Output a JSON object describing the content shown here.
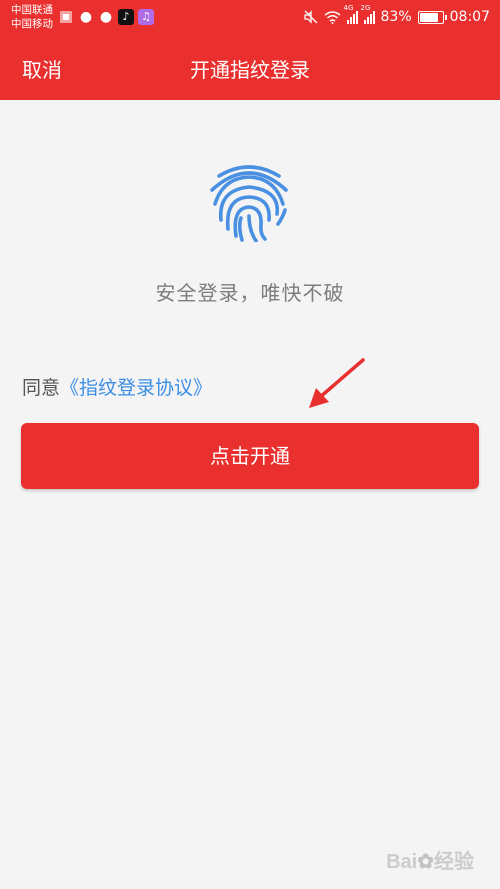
{
  "status_bar": {
    "carrier_1": "中国联通",
    "carrier_2": "中国移动",
    "network_1": "4G",
    "network_2": "2G",
    "battery": "83%",
    "battery_level": 0.83,
    "time": "08:07"
  },
  "header": {
    "cancel_label": "取消",
    "title": "开通指纹登录"
  },
  "main": {
    "tagline": "安全登录，唯快不破",
    "agree_prefix": "同意",
    "agreement_link": "《指纹登录协议》",
    "enable_button": "点击开通"
  },
  "watermark": {
    "text": "Bai",
    "suffix": "经验"
  },
  "colors": {
    "brand_red": "#e9302f",
    "link_blue": "#3a8ee6",
    "fingerprint_blue": "#4a90e2"
  },
  "icons": [
    "fingerprint-icon",
    "mute-icon",
    "wifi-icon",
    "arrow-annotation"
  ]
}
